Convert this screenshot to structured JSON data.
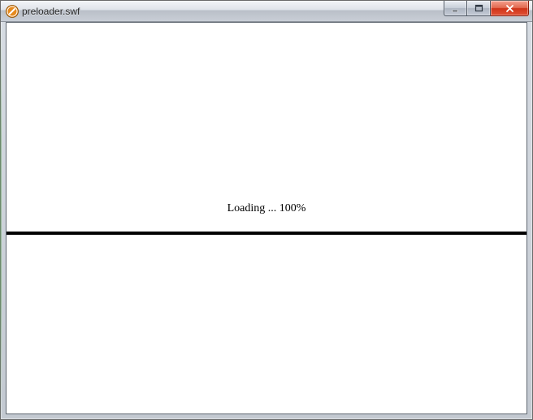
{
  "window": {
    "title": "preloader.swf"
  },
  "content": {
    "loading_prefix": "Loading ... ",
    "progress_percent": 100,
    "percent_suffix": "%"
  }
}
